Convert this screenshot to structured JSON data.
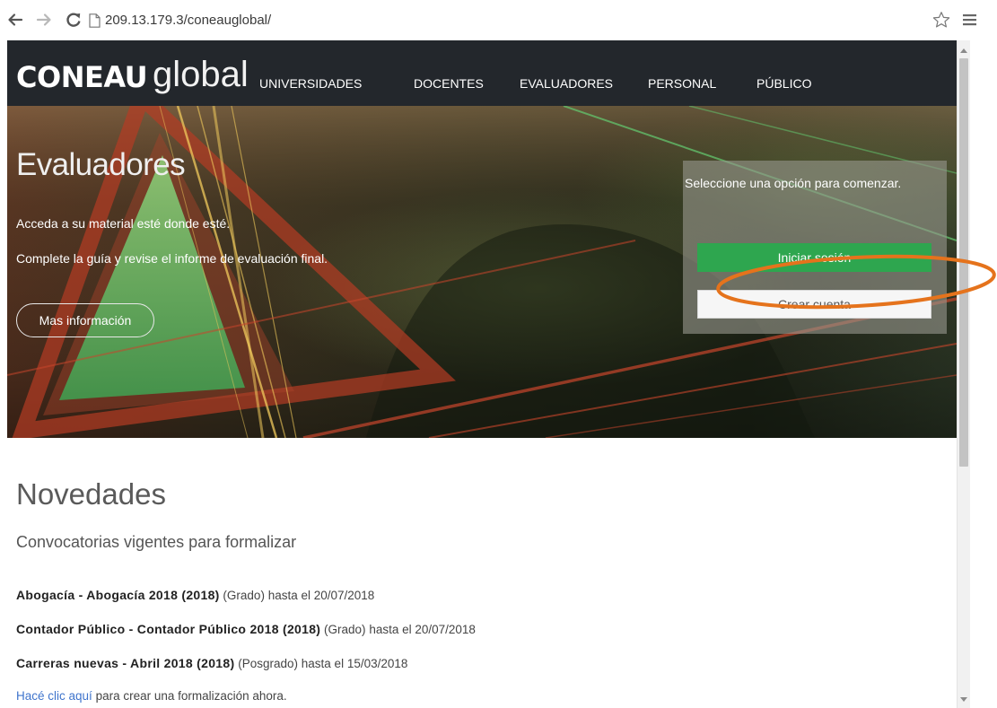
{
  "browser": {
    "url": "209.13.179.3/coneauglobal/",
    "icons": {
      "back": "back-arrow-icon",
      "forward": "forward-arrow-icon",
      "reload": "reload-icon",
      "page": "page-icon",
      "bookmark": "star-icon",
      "menu": "menu-icon"
    }
  },
  "nav": {
    "logo_brand": "CONEAU",
    "logo_suffix": "global",
    "items": [
      {
        "label": "UNIVERSIDADES"
      },
      {
        "label": "DOCENTES"
      },
      {
        "label": "EVALUADORES"
      },
      {
        "label": "PERSONAL"
      },
      {
        "label": "PÚBLICO"
      }
    ]
  },
  "hero": {
    "title": "Evaluadores",
    "lines": [
      "Acceda a su material esté donde esté.",
      "Complete la guía y revise el informe de evaluación final."
    ],
    "more_info_label": "Mas información",
    "panel": {
      "prompt": "Seleccione una opción para comenzar.",
      "login_label": "Iniciar sesión",
      "register_label": "Crear cuenta"
    }
  },
  "news": {
    "title": "Novedades",
    "subtitle": "Convocatorias vigentes para formalizar",
    "items": [
      {
        "name": "Abogacía - Abogacía 2018 (2018)",
        "level": "(Grado)",
        "deadline": "hasta el 20/07/2018"
      },
      {
        "name": "Contador Público - Contador Público 2018 (2018)",
        "level": "(Grado)",
        "deadline": "hasta el 20/07/2018"
      },
      {
        "name": "Carreras nuevas - Abril 2018 (2018)",
        "level": "(Posgrado)",
        "deadline": "hasta el 15/03/2018"
      }
    ],
    "cta": {
      "link_label": "Hacé clic aquí",
      "text": "para crear una formalización ahora."
    }
  },
  "colors": {
    "nav_bg": "#23272c",
    "login_green": "#2ea64f",
    "link_blue": "#3f74cc",
    "annotation_orange": "#e5731c"
  }
}
